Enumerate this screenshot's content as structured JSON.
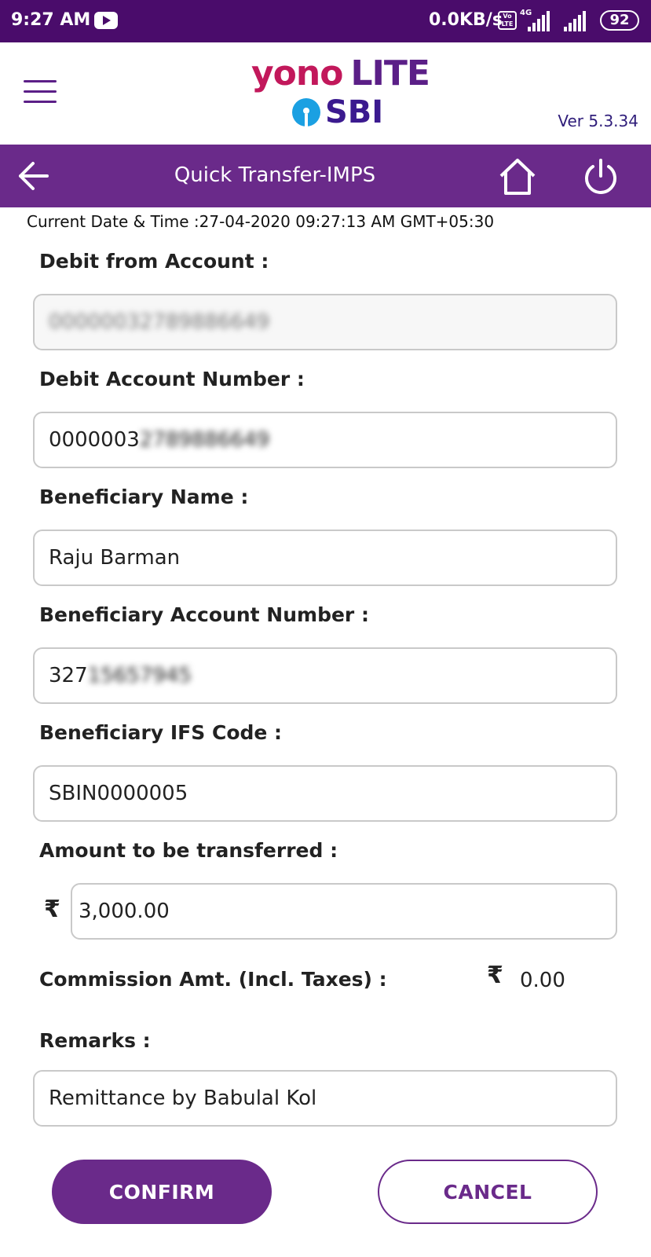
{
  "status_bar": {
    "time": "9:27 AM",
    "network_speed": "0.0KB/s",
    "volte": "Vo LTE",
    "network_type": "4G",
    "battery": "92"
  },
  "header": {
    "logo_primary": "yono",
    "logo_secondary": "LITE",
    "logo_bank": "SBI",
    "version": "Ver 5.3.34"
  },
  "nav": {
    "title": "Quick Transfer-IMPS"
  },
  "datetime": "Current Date & Time :27-04-2020 09:27:13 AM GMT+05:30",
  "form": {
    "debit_from_account": {
      "label": "Debit from Account :",
      "value_visible": "",
      "value_blurred": "00000032789886649"
    },
    "debit_account_number": {
      "label": "Debit Account Number :",
      "value_visible": "0000003",
      "value_blurred": "2789886649"
    },
    "beneficiary_name": {
      "label": "Beneficiary Name :",
      "value": "Raju Barman"
    },
    "beneficiary_account_number": {
      "label": "Beneficiary Account Number :",
      "value_visible": "327",
      "value_blurred": "15657945"
    },
    "beneficiary_ifs_code": {
      "label": "Beneficiary IFS Code :",
      "value": "SBIN0000005"
    },
    "amount": {
      "label": "Amount to be transferred :",
      "currency_symbol": "₹",
      "value": "3,000.00"
    },
    "commission": {
      "label": "Commission Amt. (Incl. Taxes) :",
      "currency_symbol": "₹",
      "value": "0.00"
    },
    "remarks": {
      "label": "Remarks :",
      "value": "Remittance by Babulal Kol"
    }
  },
  "buttons": {
    "confirm": "CONFIRM",
    "cancel": "CANCEL"
  },
  "colors": {
    "status_bar": "#4a0c6b",
    "nav_bar": "#6a2a8a",
    "brand_pink": "#c2185b",
    "brand_purple": "#5b1f87",
    "sbi_blue": "#1ba0e2"
  }
}
